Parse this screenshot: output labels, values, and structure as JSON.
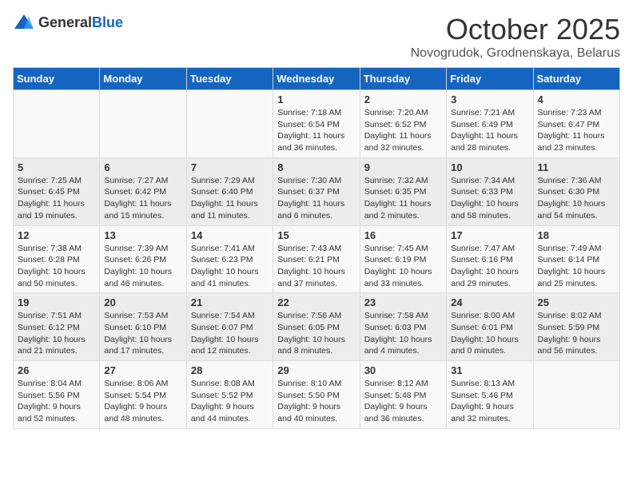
{
  "header": {
    "logo_general": "General",
    "logo_blue": "Blue",
    "month_title": "October 2025",
    "location": "Novogrudok, Grodnenskaya, Belarus"
  },
  "days_of_week": [
    "Sunday",
    "Monday",
    "Tuesday",
    "Wednesday",
    "Thursday",
    "Friday",
    "Saturday"
  ],
  "weeks": [
    [
      {
        "day": "",
        "info": ""
      },
      {
        "day": "",
        "info": ""
      },
      {
        "day": "",
        "info": ""
      },
      {
        "day": "1",
        "info": "Sunrise: 7:18 AM\nSunset: 6:54 PM\nDaylight: 11 hours\nand 36 minutes."
      },
      {
        "day": "2",
        "info": "Sunrise: 7:20 AM\nSunset: 6:52 PM\nDaylight: 11 hours\nand 32 minutes."
      },
      {
        "day": "3",
        "info": "Sunrise: 7:21 AM\nSunset: 6:49 PM\nDaylight: 11 hours\nand 28 minutes."
      },
      {
        "day": "4",
        "info": "Sunrise: 7:23 AM\nSunset: 6:47 PM\nDaylight: 11 hours\nand 23 minutes."
      }
    ],
    [
      {
        "day": "5",
        "info": "Sunrise: 7:25 AM\nSunset: 6:45 PM\nDaylight: 11 hours\nand 19 minutes."
      },
      {
        "day": "6",
        "info": "Sunrise: 7:27 AM\nSunset: 6:42 PM\nDaylight: 11 hours\nand 15 minutes."
      },
      {
        "day": "7",
        "info": "Sunrise: 7:29 AM\nSunset: 6:40 PM\nDaylight: 11 hours\nand 11 minutes."
      },
      {
        "day": "8",
        "info": "Sunrise: 7:30 AM\nSunset: 6:37 PM\nDaylight: 11 hours\nand 6 minutes."
      },
      {
        "day": "9",
        "info": "Sunrise: 7:32 AM\nSunset: 6:35 PM\nDaylight: 11 hours\nand 2 minutes."
      },
      {
        "day": "10",
        "info": "Sunrise: 7:34 AM\nSunset: 6:33 PM\nDaylight: 10 hours\nand 58 minutes."
      },
      {
        "day": "11",
        "info": "Sunrise: 7:36 AM\nSunset: 6:30 PM\nDaylight: 10 hours\nand 54 minutes."
      }
    ],
    [
      {
        "day": "12",
        "info": "Sunrise: 7:38 AM\nSunset: 6:28 PM\nDaylight: 10 hours\nand 50 minutes."
      },
      {
        "day": "13",
        "info": "Sunrise: 7:39 AM\nSunset: 6:26 PM\nDaylight: 10 hours\nand 46 minutes."
      },
      {
        "day": "14",
        "info": "Sunrise: 7:41 AM\nSunset: 6:23 PM\nDaylight: 10 hours\nand 41 minutes."
      },
      {
        "day": "15",
        "info": "Sunrise: 7:43 AM\nSunset: 6:21 PM\nDaylight: 10 hours\nand 37 minutes."
      },
      {
        "day": "16",
        "info": "Sunrise: 7:45 AM\nSunset: 6:19 PM\nDaylight: 10 hours\nand 33 minutes."
      },
      {
        "day": "17",
        "info": "Sunrise: 7:47 AM\nSunset: 6:16 PM\nDaylight: 10 hours\nand 29 minutes."
      },
      {
        "day": "18",
        "info": "Sunrise: 7:49 AM\nSunset: 6:14 PM\nDaylight: 10 hours\nand 25 minutes."
      }
    ],
    [
      {
        "day": "19",
        "info": "Sunrise: 7:51 AM\nSunset: 6:12 PM\nDaylight: 10 hours\nand 21 minutes."
      },
      {
        "day": "20",
        "info": "Sunrise: 7:53 AM\nSunset: 6:10 PM\nDaylight: 10 hours\nand 17 minutes."
      },
      {
        "day": "21",
        "info": "Sunrise: 7:54 AM\nSunset: 6:07 PM\nDaylight: 10 hours\nand 12 minutes."
      },
      {
        "day": "22",
        "info": "Sunrise: 7:56 AM\nSunset: 6:05 PM\nDaylight: 10 hours\nand 8 minutes."
      },
      {
        "day": "23",
        "info": "Sunrise: 7:58 AM\nSunset: 6:03 PM\nDaylight: 10 hours\nand 4 minutes."
      },
      {
        "day": "24",
        "info": "Sunrise: 8:00 AM\nSunset: 6:01 PM\nDaylight: 10 hours\nand 0 minutes."
      },
      {
        "day": "25",
        "info": "Sunrise: 8:02 AM\nSunset: 5:59 PM\nDaylight: 9 hours\nand 56 minutes."
      }
    ],
    [
      {
        "day": "26",
        "info": "Sunrise: 8:04 AM\nSunset: 5:56 PM\nDaylight: 9 hours\nand 52 minutes."
      },
      {
        "day": "27",
        "info": "Sunrise: 8:06 AM\nSunset: 5:54 PM\nDaylight: 9 hours\nand 48 minutes."
      },
      {
        "day": "28",
        "info": "Sunrise: 8:08 AM\nSunset: 5:52 PM\nDaylight: 9 hours\nand 44 minutes."
      },
      {
        "day": "29",
        "info": "Sunrise: 8:10 AM\nSunset: 5:50 PM\nDaylight: 9 hours\nand 40 minutes."
      },
      {
        "day": "30",
        "info": "Sunrise: 8:12 AM\nSunset: 5:48 PM\nDaylight: 9 hours\nand 36 minutes."
      },
      {
        "day": "31",
        "info": "Sunrise: 8:13 AM\nSunset: 5:46 PM\nDaylight: 9 hours\nand 32 minutes."
      },
      {
        "day": "",
        "info": ""
      }
    ]
  ]
}
